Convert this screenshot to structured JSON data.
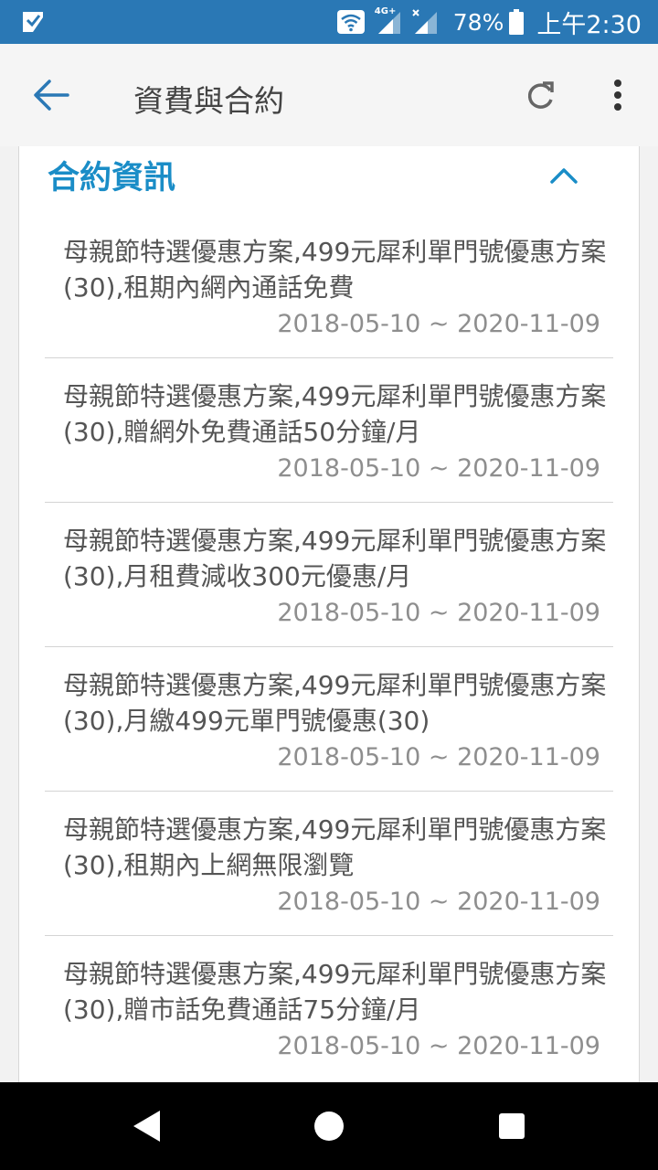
{
  "status_bar": {
    "network_tag": "4G+",
    "battery_percent": "78%",
    "time": "上午2:30"
  },
  "app_bar": {
    "title": "資費與合約"
  },
  "section": {
    "title": "合約資訊",
    "items": [
      {
        "desc": "母親節特選優惠方案,499元犀利單門號優惠方案(30),租期內網內通話免費",
        "period": "2018-05-10 ~ 2020-11-09"
      },
      {
        "desc": "母親節特選優惠方案,499元犀利單門號優惠方案(30),贈網外免費通話50分鐘/月",
        "period": "2018-05-10 ~ 2020-11-09"
      },
      {
        "desc": "母親節特選優惠方案,499元犀利單門號優惠方案(30),月租費減收300元優惠/月",
        "period": "2018-05-10 ~ 2020-11-09"
      },
      {
        "desc": "母親節特選優惠方案,499元犀利單門號優惠方案(30),月繳499元單門號優惠(30)",
        "period": "2018-05-10 ~ 2020-11-09"
      },
      {
        "desc": "母親節特選優惠方案,499元犀利單門號優惠方案(30),租期內上網無限瀏覽",
        "period": "2018-05-10 ~ 2020-11-09"
      },
      {
        "desc": "母親節特選優惠方案,499元犀利單門號優惠方案(30),贈市話免費通話75分鐘/月",
        "period": "2018-05-10 ~ 2020-11-09"
      }
    ]
  },
  "icons": {
    "status_app": "app-notification-icon",
    "wifi": "wifi-icon",
    "signal": "cell-signal-icon",
    "battery": "battery-icon",
    "back": "arrow-back-icon",
    "refresh": "refresh-icon",
    "more": "more-vert-icon",
    "collapse": "chevron-up-icon",
    "nav_back": "nav-back-icon",
    "nav_home": "nav-home-icon",
    "nav_recents": "nav-recents-icon"
  },
  "colors": {
    "status_bar": "#2a78b5",
    "accent": "#1a8dc7",
    "background": "#f2f2f2",
    "card": "#ffffff"
  }
}
